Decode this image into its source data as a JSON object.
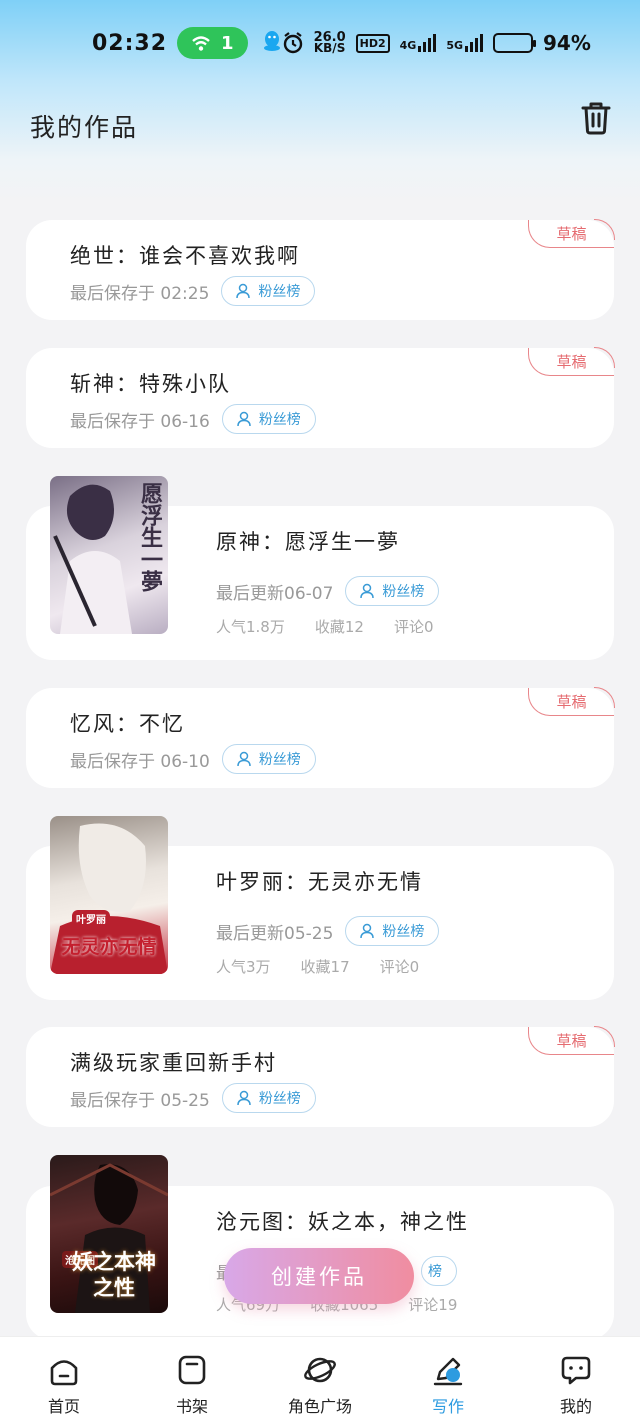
{
  "status_bar": {
    "time": "02:32",
    "wifi_count": "1",
    "net_speed_value": "26.0",
    "net_speed_unit": "KB/S",
    "hd": "HD2",
    "network_1": "4G",
    "network_2": "5G",
    "battery": "94%",
    "battery_level": 0.94
  },
  "header": {
    "title": "我的作品",
    "trash_icon": "trash-icon"
  },
  "works": [
    {
      "title": "绝世：谁会不喜欢我啊",
      "meta": "最后保存于 02:25",
      "fan_label": "粉丝榜",
      "tag": "草稿"
    },
    {
      "title": "斩神：特殊小队",
      "meta": "最后保存于 06-16",
      "fan_label": "粉丝榜",
      "tag": "草稿"
    },
    {
      "title": "原神：愿浮生一夢",
      "meta": "最后更新06-07",
      "fan_label": "粉丝榜",
      "stats": [
        "人气1.8万",
        "收藏12",
        "评论0"
      ],
      "cover_text": "愿浮生一夢"
    },
    {
      "title": "忆风：不忆",
      "meta": "最后保存于 06-10",
      "fan_label": "粉丝榜",
      "tag": "草稿"
    },
    {
      "title": "叶罗丽：无灵亦无情",
      "meta": "最后更新05-25",
      "fan_label": "粉丝榜",
      "stats": [
        "人气3万",
        "收藏17",
        "评论0"
      ],
      "cover_text": "无灵亦无情",
      "cover_subtext": "叶罗丽"
    },
    {
      "title": "满级玩家重回新手村",
      "meta": "最后保存于 05-25",
      "fan_label": "粉丝榜",
      "tag": "草稿"
    },
    {
      "title": "沧元图：妖之本，神之性",
      "meta": "最",
      "fan_label": "榜",
      "stats": [
        "人气69万",
        "收藏1065",
        "评论19"
      ],
      "cover_text": "妖之本神之性",
      "cover_subtext": "沧元图"
    }
  ],
  "create_button": "创建作品",
  "nav": [
    {
      "label": "首页",
      "icon": "home-icon"
    },
    {
      "label": "书架",
      "icon": "bookshelf-icon"
    },
    {
      "label": "角色广场",
      "icon": "planet-icon"
    },
    {
      "label": "写作",
      "icon": "pen-icon"
    },
    {
      "label": "我的",
      "icon": "chat-bubble-icon"
    }
  ],
  "colors": {
    "accent": "#2d9be0",
    "draft_tag": "#e56b70",
    "create_gradient_start": "#d8a8e8",
    "create_gradient_end": "#f08da0"
  }
}
